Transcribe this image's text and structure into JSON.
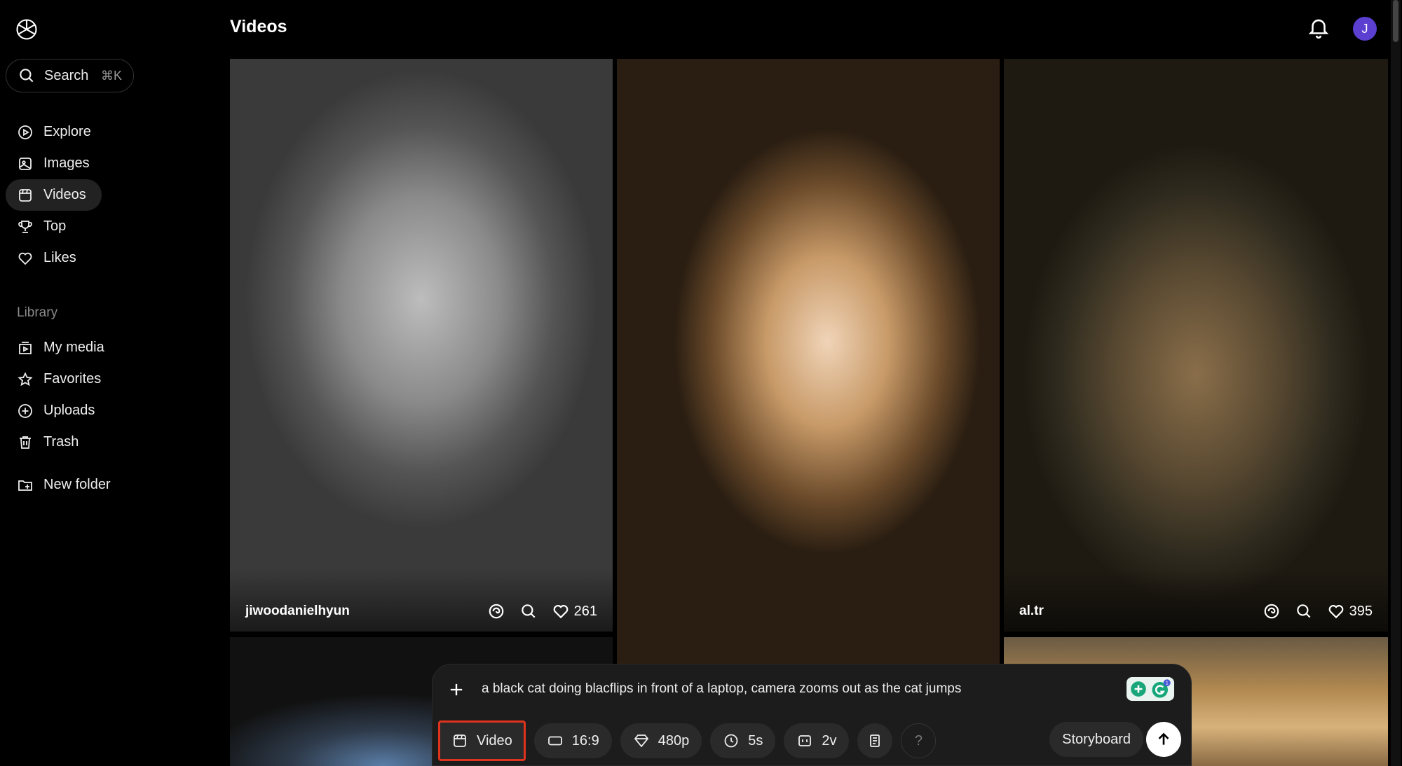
{
  "sidebar": {
    "search": {
      "label": "Search",
      "shortcut": "⌘K"
    },
    "nav": [
      {
        "label": "Explore",
        "icon": "explore-icon"
      },
      {
        "label": "Images",
        "icon": "images-icon"
      },
      {
        "label": "Videos",
        "icon": "videos-icon",
        "active": true
      },
      {
        "label": "Top",
        "icon": "trophy-icon"
      },
      {
        "label": "Likes",
        "icon": "heart-icon"
      }
    ],
    "library_label": "Library",
    "library": [
      {
        "label": "My media",
        "icon": "media-icon"
      },
      {
        "label": "Favorites",
        "icon": "star-icon"
      },
      {
        "label": "Uploads",
        "icon": "upload-icon"
      },
      {
        "label": "Trash",
        "icon": "trash-icon"
      }
    ],
    "new_folder": "New folder"
  },
  "header": {
    "title": "Videos",
    "avatar_initial": "J"
  },
  "feed": [
    {
      "user": "jiwoodanielhyun",
      "likes": "261"
    },
    {
      "user": "",
      "likes": ""
    },
    {
      "user": "al.tr",
      "likes": "395"
    }
  ],
  "composer": {
    "prompt": "a black cat doing blacflips in front of a laptop, camera zooms out as the cat jumps",
    "extension_badge": "1",
    "chips": {
      "type": "Video",
      "aspect": "16:9",
      "resolution": "480p",
      "duration": "5s",
      "variations": "2v",
      "help": "?"
    },
    "storyboard": "Storyboard"
  },
  "colors": {
    "accent": "#5b3fd1",
    "highlight_border": "#e0331e"
  }
}
